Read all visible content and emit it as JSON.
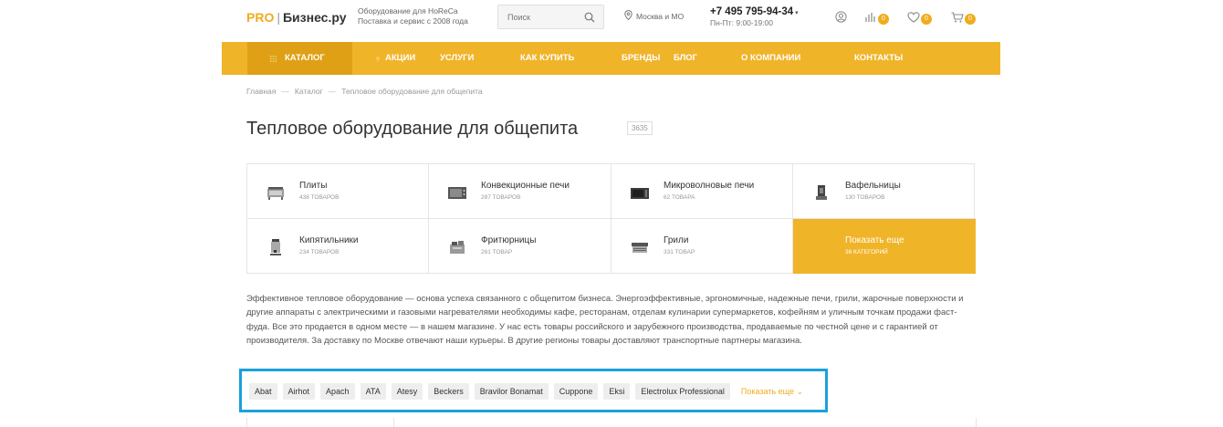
{
  "header": {
    "logo_pro": "PRO",
    "logo_sep": "|",
    "logo_name": "Бизнес.ру",
    "tagline_line1": "Оборудование для HoReCa",
    "tagline_line2": "Поставка и сервис с 2008 года",
    "search_placeholder": "Поиск",
    "location": "Москва и МО",
    "phone": "+7 495 795-94-34",
    "hours": "Пн-Пт: 9:00-19:00",
    "compare_count": "0",
    "favorites_count": "0",
    "cart_count": "0"
  },
  "nav": {
    "items": [
      {
        "label": "КАТАЛОГ",
        "icon": "grid-icon"
      },
      {
        "label": "АКЦИИ",
        "icon": "lightning-icon"
      },
      {
        "label": "УСЛУГИ"
      },
      {
        "label": "КАК КУПИТЬ"
      },
      {
        "label": "БРЕНДЫ"
      },
      {
        "label": "БЛОГ"
      },
      {
        "label": "О КОМПАНИИ"
      },
      {
        "label": "КОНТАКТЫ"
      }
    ]
  },
  "breadcrumb": {
    "items": [
      "Главная",
      "Каталог",
      "Тепловое оборудование для общепита"
    ],
    "separator": "—"
  },
  "page": {
    "title": "Тепловое оборудование для общепита",
    "count": "3635"
  },
  "categories": [
    {
      "name": "Плиты",
      "count": "438 товаров",
      "icon": "stove-icon"
    },
    {
      "name": "Конвекционные печи",
      "count": "287 товаров",
      "icon": "convection-oven-icon"
    },
    {
      "name": "Микроволновые печи",
      "count": "62 товара",
      "icon": "microwave-icon"
    },
    {
      "name": "Вафельницы",
      "count": "130 товаров",
      "icon": "waffle-maker-icon"
    },
    {
      "name": "Кипятильники",
      "count": "234 товаров",
      "icon": "water-boiler-icon"
    },
    {
      "name": "Фритюрницы",
      "count": "261 товар",
      "icon": "fryer-icon"
    },
    {
      "name": "Грили",
      "count": "331 товар",
      "icon": "grill-icon"
    },
    {
      "name": "Показать еще",
      "count": "36 категорий"
    }
  ],
  "description": "Эффективное тепловое оборудование — основа успеха связанного с общепитом бизнеса. Энергоэффективные, эргономичные, надежные печи, грили, жарочные поверхности и другие аппараты с электрическими и газовыми нагревателями необходимы кафе, ресторанам, отделам кулинарии супермаркетов, кофейням и уличным точкам продажи фаст-фуда. Все это продается в одном месте — в нашем магазине. У нас есть товары российского и зарубежного производства, продаваемые по честной цене и с гарантией от производителя. За доставку по Москве отвечают наши курьеры. В другие регионы товары доставляют транспортные партнеры магазина.",
  "brands": {
    "tags": [
      "Abat",
      "Airhot",
      "Apach",
      "ATA",
      "Atesy",
      "Beckers",
      "Bravilor Bonamat",
      "Cuppone",
      "Eksi",
      "Electrolux Professional"
    ],
    "show_more": "Показать еще"
  },
  "colors": {
    "accent": "#f0b429",
    "accent_dark": "#dfa016",
    "highlight_border": "#1aa0dc"
  }
}
